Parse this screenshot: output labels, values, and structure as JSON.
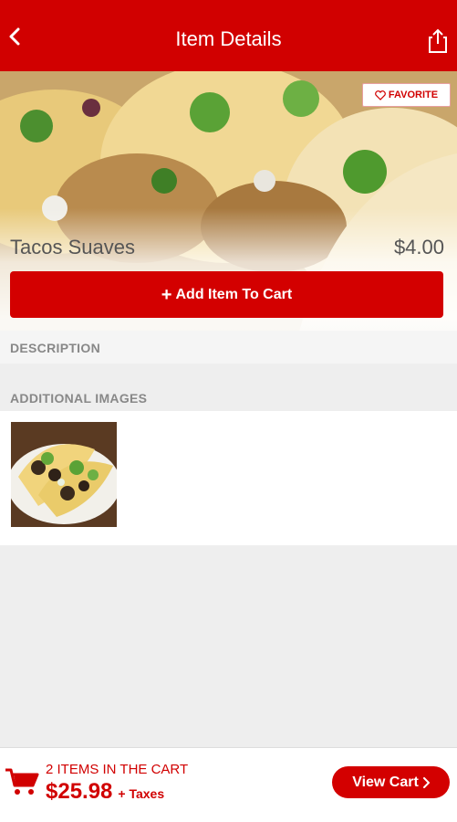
{
  "header": {
    "title": "Item Details",
    "back_icon": "chevron-left-icon",
    "share_icon": "share-icon"
  },
  "item": {
    "name": "Tacos Suaves",
    "price": "$4.00",
    "favorite_label": "FAVORITE",
    "add_to_cart_label": "Add Item To Cart"
  },
  "sections": {
    "description_label": "DESCRIPTION",
    "additional_images_label": "ADDITIONAL IMAGES"
  },
  "cart": {
    "count_text": "2 ITEMS IN THE CART",
    "total": "$25.98",
    "taxes_text": "+ Taxes",
    "view_cart_label": "View Cart"
  },
  "colors": {
    "brand_red": "#d10000",
    "panel_gray": "#eeeeee"
  }
}
